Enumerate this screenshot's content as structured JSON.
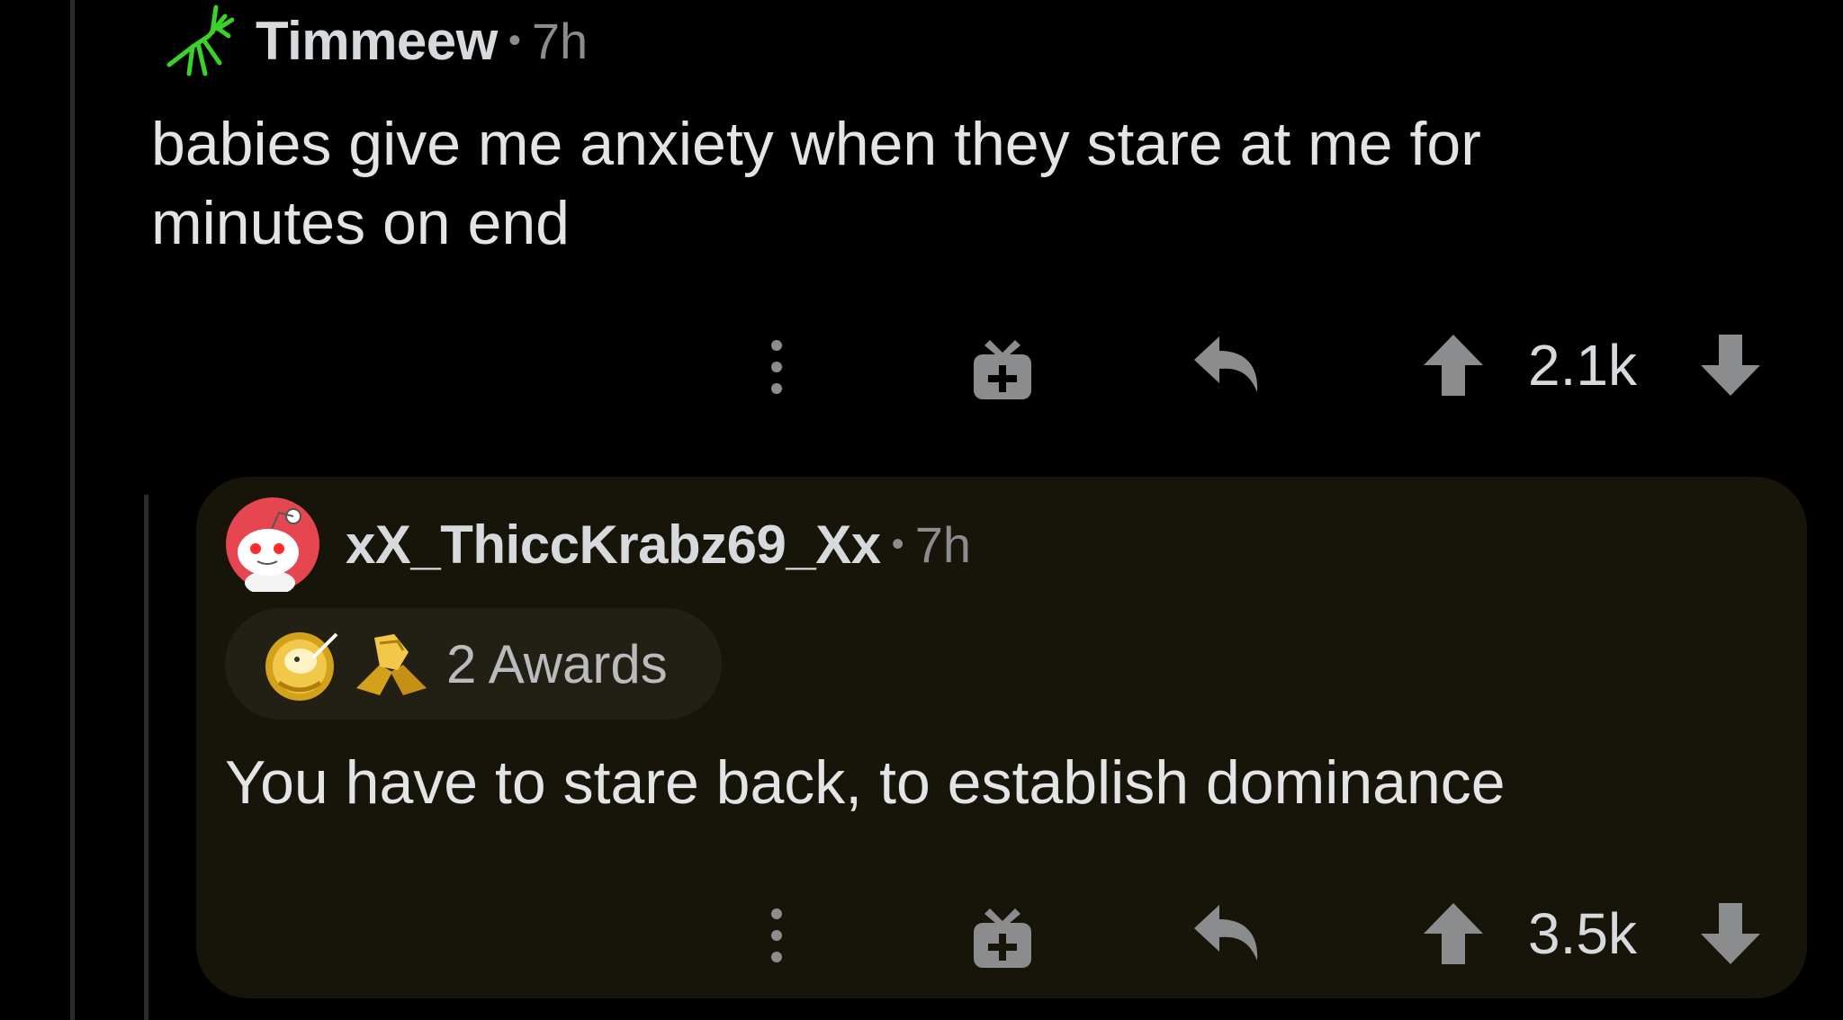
{
  "comment": {
    "author": "Timmeew",
    "separator": "•",
    "time": "7h",
    "body": "babies give me anxiety when they stare at me for minutes on end",
    "score": "2.1k",
    "avatar_icon": "green-mantis-avatar-icon"
  },
  "reply": {
    "author": "xX_ThiccKrabz69_Xx",
    "separator": "•",
    "time": "7h",
    "awards_label": "2 Awards",
    "body": "You have to stare back, to establish dominance",
    "score": "3.5k",
    "avatar_icon": "snoo-avatar-icon"
  },
  "action_icons": [
    "more-options-icon",
    "gift-award-icon",
    "reply-arrow-icon",
    "upvote-arrow-icon",
    "downvote-arrow-icon"
  ],
  "colors": {
    "background": "#000000",
    "card": "#17140a",
    "text": "#d7dadc",
    "muted": "#8a8c8e",
    "mantis_green": "#3ad12a",
    "snoo_red": "#e6464f",
    "award_gold": "#d4a11b"
  }
}
